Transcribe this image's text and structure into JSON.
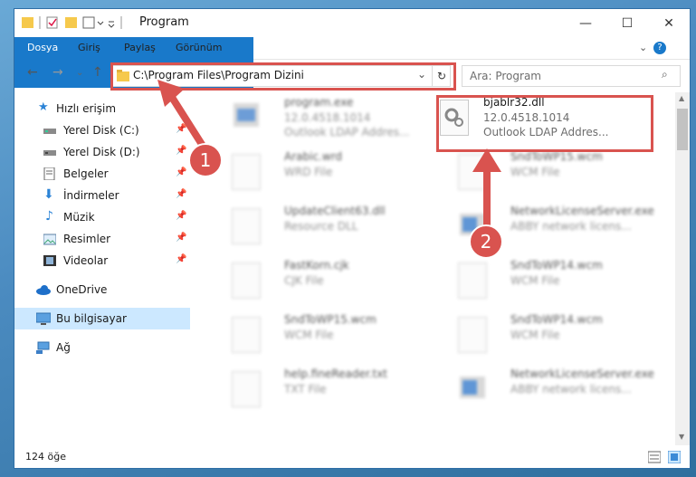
{
  "window": {
    "title": "Program",
    "controls": {
      "minimize": "—",
      "maximize": "☐",
      "close": "✕"
    }
  },
  "ribbon": {
    "tabs": [
      "Dosya",
      "Giriş",
      "Paylaş",
      "Görünüm"
    ],
    "help": "?"
  },
  "navigation": {
    "address": "C:\\Program Files\\Program Dizini",
    "search_placeholder": "Ara: Program"
  },
  "sidebar": {
    "items": [
      {
        "label": "Hızlı erişim",
        "icon": "star-icon"
      },
      {
        "label": "Yerel Disk (C:)",
        "icon": "drive-icon"
      },
      {
        "label": "Yerel Disk (D:)",
        "icon": "drive-icon"
      },
      {
        "label": "Belgeler",
        "icon": "documents-icon"
      },
      {
        "label": "İndirmeler",
        "icon": "download-icon"
      },
      {
        "label": "Müzik",
        "icon": "music-icon"
      },
      {
        "label": "Resimler",
        "icon": "pictures-icon"
      },
      {
        "label": "Videolar",
        "icon": "videos-icon"
      },
      {
        "label": "OneDrive",
        "icon": "cloud-icon"
      },
      {
        "label": "Bu bilgisayar",
        "icon": "computer-icon"
      },
      {
        "label": "Ağ",
        "icon": "network-icon"
      }
    ]
  },
  "files": [
    {
      "name": "program.exe",
      "line1": "12.0.4518.1014",
      "line2": "Outlook LDAP Addres..."
    },
    {
      "name": "bjablr32.dll",
      "line1": "12.0.4518.1014",
      "line2": "Outlook LDAP Addres..."
    },
    {
      "name": "Arabic.wrd",
      "line1": "WRD File",
      "line2": ""
    },
    {
      "name": "SndToWP15.wcm",
      "line1": "WCM File",
      "line2": ""
    },
    {
      "name": "UpdateClient63.dll",
      "line1": "Resource DLL",
      "line2": ""
    },
    {
      "name": "NetworkLicenseServer.exe",
      "line1": "ABBY network licens...",
      "line2": ""
    },
    {
      "name": "FastKorn.cjk",
      "line1": "CJK File",
      "line2": ""
    },
    {
      "name": "SndToWP14.wcm",
      "line1": "WCM File",
      "line2": ""
    },
    {
      "name": "SndToWP15.wcm",
      "line1": "WCM File",
      "line2": ""
    },
    {
      "name": "SndToWP14.wcm",
      "line1": "WCM File",
      "line2": ""
    },
    {
      "name": "help.fineReader.txt",
      "line1": "TXT File",
      "line2": ""
    },
    {
      "name": "NetworkLicenseServer.exe",
      "line1": "ABBY network licens...",
      "line2": ""
    }
  ],
  "status": {
    "count": "124 öğe"
  },
  "annotations": {
    "badge1": "1",
    "badge2": "2",
    "color": "#d9534f"
  }
}
